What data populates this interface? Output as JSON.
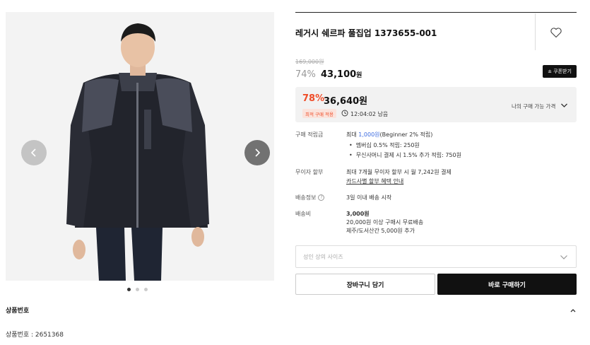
{
  "gallery": {
    "prev_icon": "chevron-left-icon",
    "next_icon": "chevron-right-icon",
    "dots": 3,
    "active_dot": 0
  },
  "product": {
    "title": "레거시 쉐르파 풀집업 1373655-001",
    "original_price": "169,000원",
    "discount_pct": "74%",
    "price": "43,100",
    "price_unit": "원",
    "coupon_button": "± 쿠폰받기"
  },
  "best_price": {
    "pct": "78%",
    "price": "36,640원",
    "badge": "최적 구매 적용",
    "timer": "12:04:02 남음",
    "my_price_label": "나의 구매 가능 가격"
  },
  "details": {
    "points_label": "구매 적립금",
    "points_value_prefix": "최대 ",
    "points_value_amount": "1,000원",
    "points_value_suffix": "(Beginner 2% 적립)",
    "points_bullets": [
      "멤버십 0.5% 적립: 250원",
      "무신사머니 결제 시 1.5% 추가 적립: 750원"
    ],
    "installment_label": "무이자 할부",
    "installment_value": "최대 7개월 무이자 할부 시 월 7,242원 결제",
    "installment_link": "카드사별 할부 혜택 안내",
    "shipping_info_label": "배송정보",
    "shipping_info_value": "3일 이내 배송 시작",
    "shipping_fee_label": "배송비",
    "shipping_fee_amount": "3,000원",
    "shipping_fee_free": "20,000원 이상 구매시 무료배송",
    "shipping_fee_island": "제주/도서산간 5,000원 추가"
  },
  "size_select": {
    "placeholder": "성인 상의 사이즈"
  },
  "actions": {
    "cart": "장바구니 담기",
    "buy": "바로 구매하기"
  },
  "info": {
    "title": "상품번호",
    "line": "상품번호 : 2651368"
  },
  "colors": {
    "accent": "#ef4d29",
    "link_blue": "#3b6ae0",
    "dark": "#111111"
  }
}
